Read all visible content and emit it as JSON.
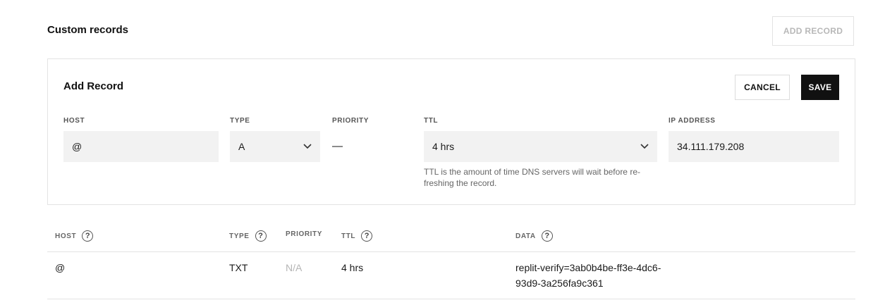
{
  "section": {
    "title": "Custom records",
    "add_record_label": "ADD RECORD"
  },
  "form": {
    "title": "Add Record",
    "cancel_label": "CANCEL",
    "save_label": "SAVE",
    "labels": {
      "host": "HOST",
      "type": "TYPE",
      "priority": "PRIORITY",
      "ttl": "TTL",
      "ip": "IP ADDRESS"
    },
    "values": {
      "host": "@",
      "type": "A",
      "priority": "—",
      "ttl": "4 hrs",
      "ip": "34.111.179.208"
    },
    "ttl_help": "TTL is the amount of time DNS servers will wait before re-freshing the record."
  },
  "table": {
    "headers": {
      "host": "HOST",
      "type": "TYPE",
      "priority": "PRIORITY",
      "ttl": "TTL",
      "data": "DATA"
    },
    "rows": [
      {
        "host": "@",
        "type": "TXT",
        "priority": "N/A",
        "ttl": "4 hrs",
        "data": "replit-verify=3ab0b4be-ff3e-4dc6-93d9-3a256fa9c361"
      }
    ]
  },
  "icons": {
    "help": "help-circle-icon",
    "dropdown": "chevron-down-icon"
  }
}
